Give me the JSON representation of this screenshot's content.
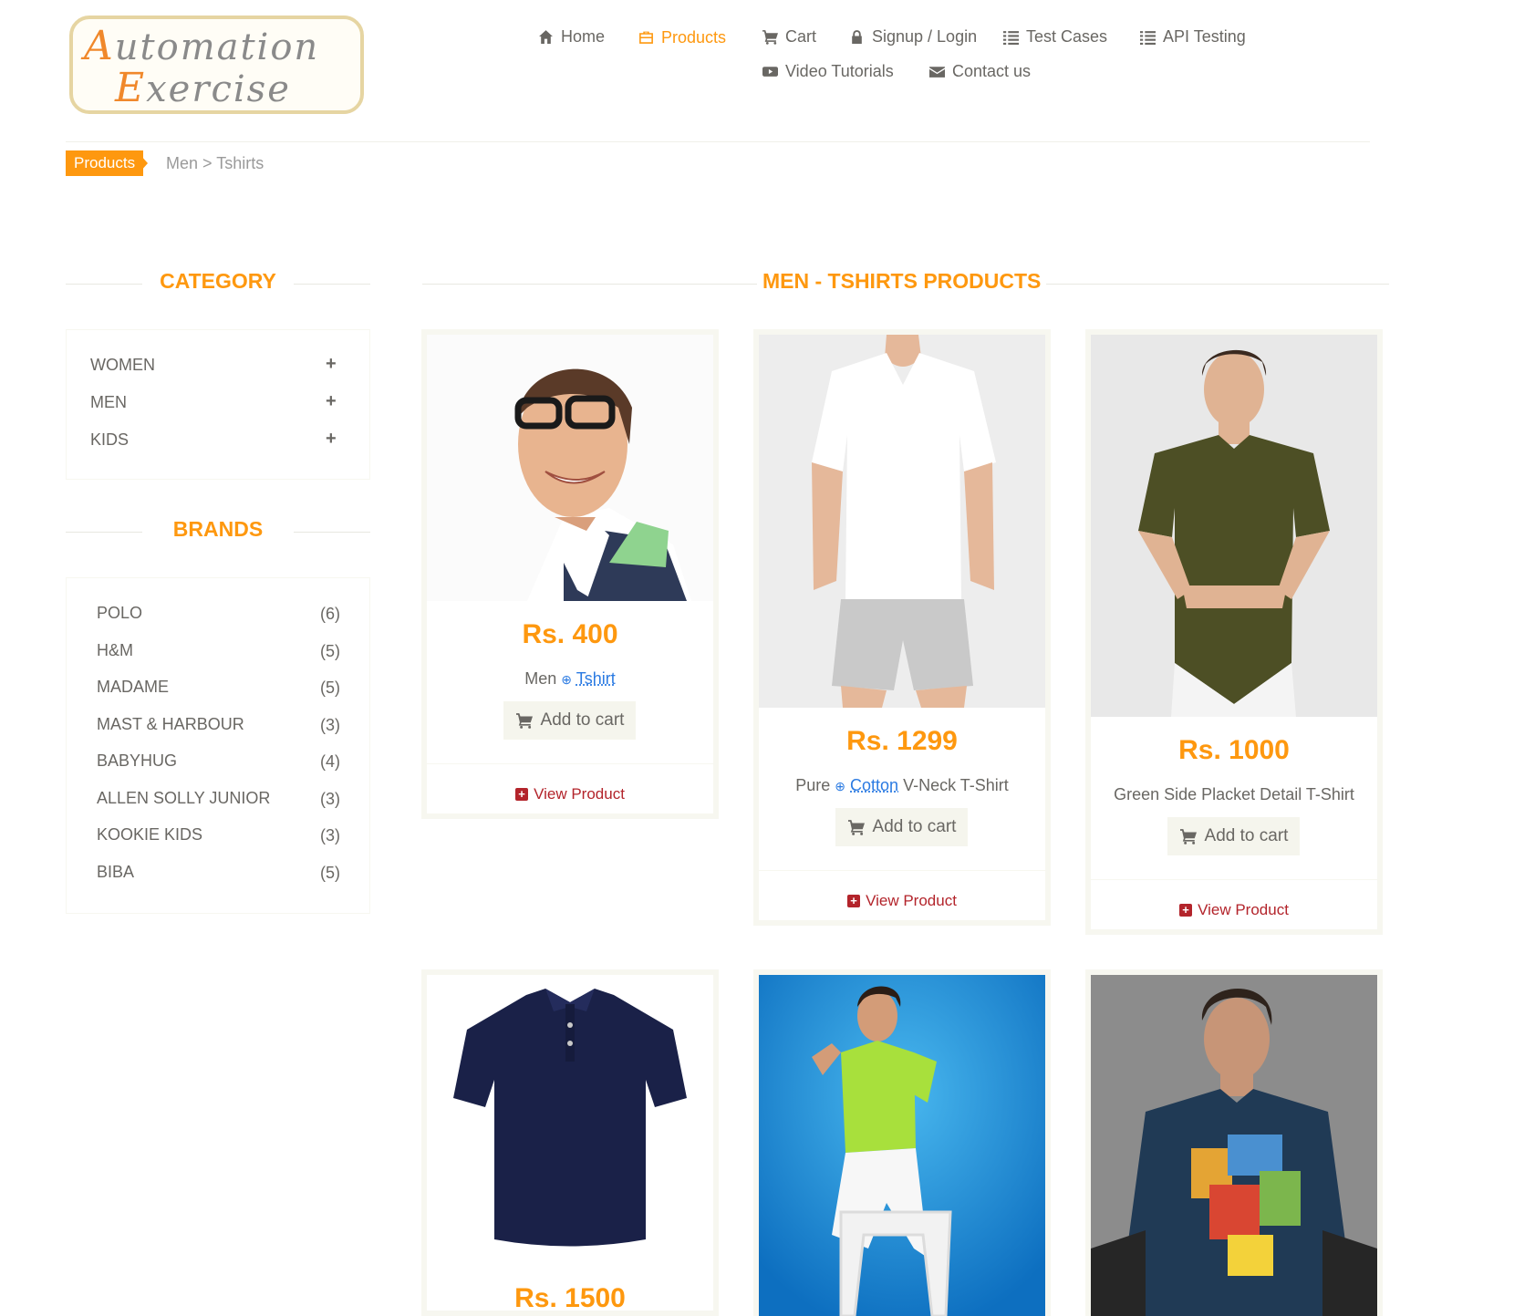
{
  "logo": {
    "line1_cap": "A",
    "line1_rest": "utomation",
    "line2_cap": "E",
    "line2_rest": "xercise"
  },
  "nav": {
    "home": "Home",
    "products": "Products",
    "cart": "Cart",
    "signup": "Signup / Login",
    "test_cases": "Test Cases",
    "api_testing": "API Testing",
    "video_tutorials": "Video Tutorials",
    "contact_us": "Contact us"
  },
  "breadcrumb": {
    "active": "Products",
    "rest": "Men > Tshirts"
  },
  "sidebar": {
    "category_title": "CATEGORY",
    "categories": [
      {
        "label": "WOMEN",
        "toggle": "+"
      },
      {
        "label": "MEN",
        "toggle": "+"
      },
      {
        "label": "KIDS",
        "toggle": "+"
      }
    ],
    "brands_title": "BRANDS",
    "brands": [
      {
        "name": "POLO",
        "count": "(6)"
      },
      {
        "name": "H&M",
        "count": "(5)"
      },
      {
        "name": "MADAME",
        "count": "(5)"
      },
      {
        "name": "MAST & HARBOUR",
        "count": "(3)"
      },
      {
        "name": "BABYHUG",
        "count": "(4)"
      },
      {
        "name": "ALLEN SOLLY JUNIOR",
        "count": "(3)"
      },
      {
        "name": "KOOKIE KIDS",
        "count": "(3)"
      },
      {
        "name": "BIBA",
        "count": "(5)"
      }
    ]
  },
  "main": {
    "title": "MEN - TSHIRTS PRODUCTS",
    "add_to_cart": "Add to cart",
    "view_product": "View Product",
    "products": [
      {
        "price": "Rs. 400",
        "name_pre": "Men",
        "name_link": "Tshirt",
        "name_post": ""
      },
      {
        "price": "Rs. 1299",
        "name_pre": "Pure",
        "name_link": "Cotton",
        "name_post": "V-Neck T-Shirt"
      },
      {
        "price": "Rs. 1000",
        "name_full": "Green Side Placket Detail T-Shirt"
      },
      {
        "price": "Rs. 1500"
      }
    ]
  }
}
